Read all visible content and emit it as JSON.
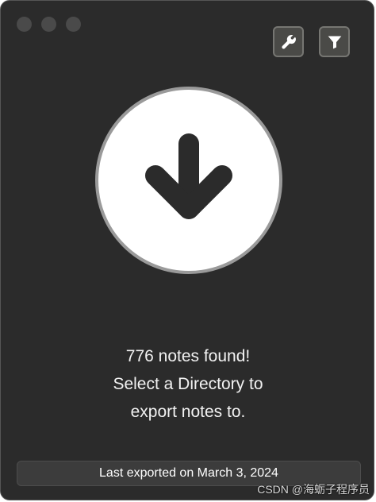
{
  "window": {
    "traffic_lights": [
      "close",
      "minimize",
      "zoom"
    ]
  },
  "toolbar": {
    "settings_icon": "wrench-icon",
    "filter_icon": "filter-icon"
  },
  "main": {
    "download_icon": "arrow-down-icon",
    "message_lines": [
      "776 notes found!",
      "Select a Directory to",
      "export notes to."
    ]
  },
  "status": {
    "last_exported": "Last exported on March 3, 2024"
  },
  "watermark": {
    "text": "CSDN @海蛎子程序员"
  },
  "colors": {
    "window_bg": "#2b2b2b",
    "button_bg": "#4a4a47",
    "circle_bg": "#ffffff",
    "arrow": "#2b2b2b",
    "text": "#f2f2f2"
  }
}
